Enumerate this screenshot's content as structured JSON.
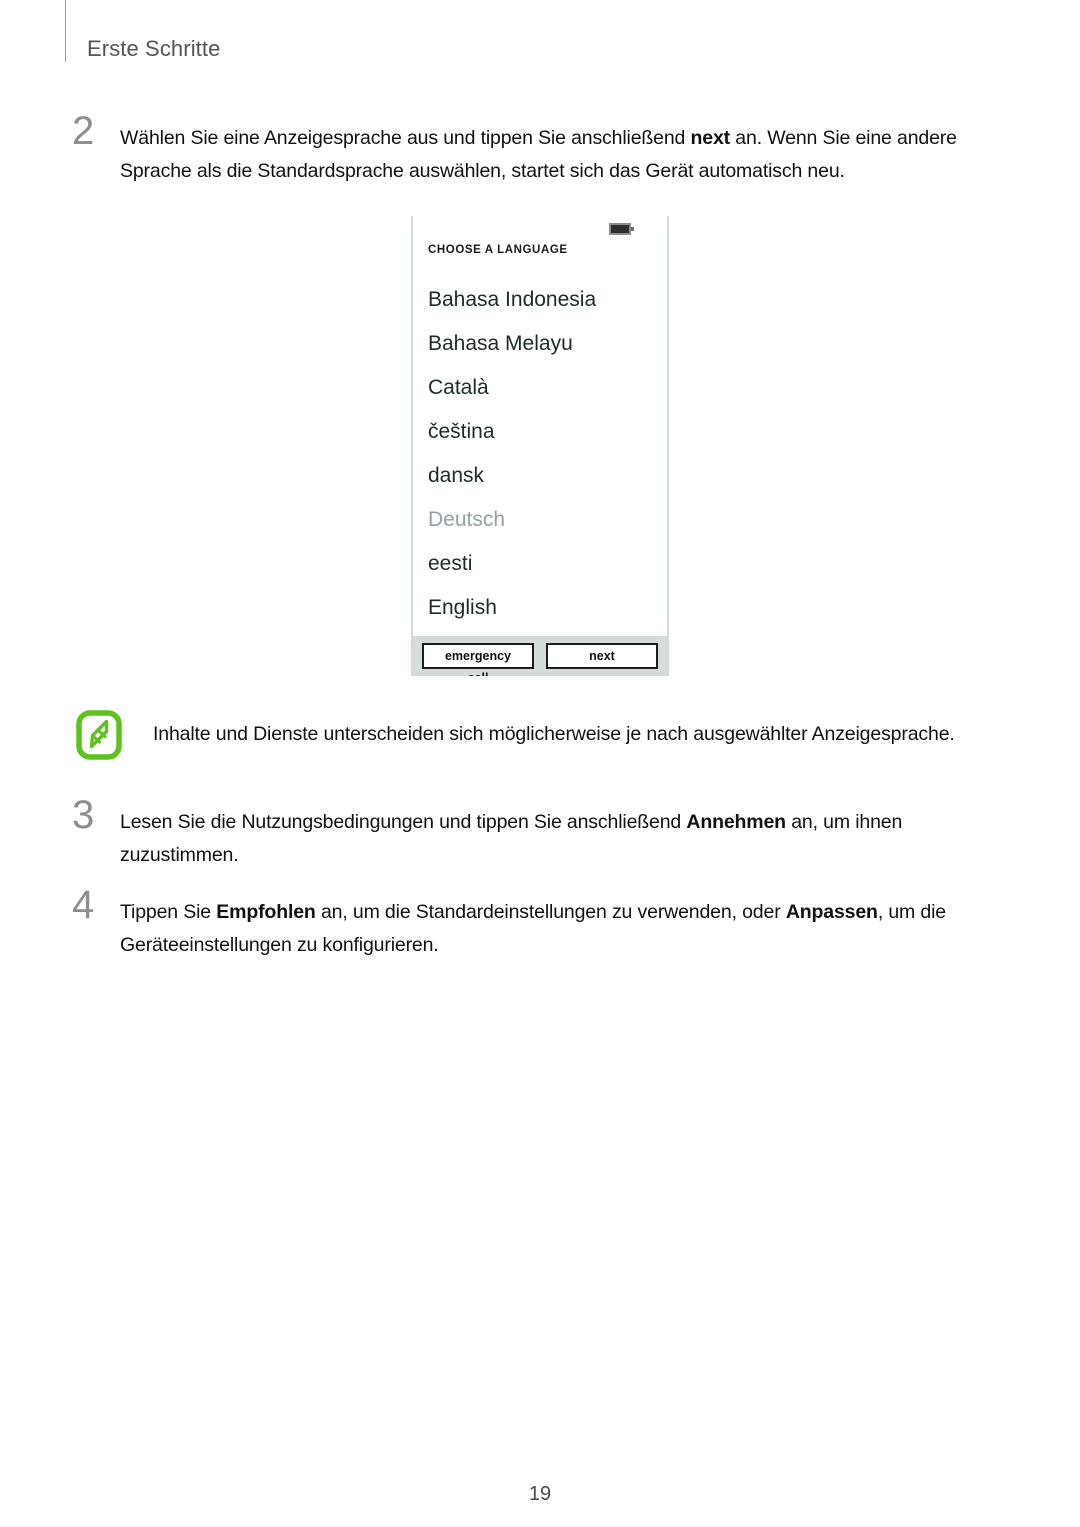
{
  "header": {
    "title": "Erste Schritte"
  },
  "steps": [
    {
      "number": "2",
      "parts": [
        {
          "text": "Wählen Sie eine Anzeigesprache aus und tippen Sie anschließend ",
          "bold": false
        },
        {
          "text": "next",
          "bold": true
        },
        {
          "text": " an. Wenn Sie eine andere Sprache als die Standardsprache auswählen, startet sich das Gerät automatisch neu.",
          "bold": false
        }
      ]
    },
    {
      "number": "3",
      "parts": [
        {
          "text": "Lesen Sie die Nutzungsbedingungen und tippen Sie anschließend ",
          "bold": false
        },
        {
          "text": "Annehmen",
          "bold": true
        },
        {
          "text": " an, um ihnen zuzustimmen.",
          "bold": false
        }
      ]
    },
    {
      "number": "4",
      "parts": [
        {
          "text": "Tippen Sie ",
          "bold": false
        },
        {
          "text": "Empfohlen",
          "bold": true
        },
        {
          "text": " an, um die Standardeinstellungen zu verwenden, oder ",
          "bold": false
        },
        {
          "text": "Anpassen",
          "bold": true
        },
        {
          "text": ", um die Geräteeinstellungen zu konfigurieren.",
          "bold": false
        }
      ]
    }
  ],
  "device_screenshot": {
    "status_bar": {
      "battery_icon": "battery-icon"
    },
    "title": "CHOOSE A LANGUAGE",
    "languages": [
      {
        "label": "Bahasa Indonesia",
        "selected": false
      },
      {
        "label": "Bahasa Melayu",
        "selected": false
      },
      {
        "label": "Català",
        "selected": false
      },
      {
        "label": "čeština",
        "selected": false
      },
      {
        "label": "dansk",
        "selected": false
      },
      {
        "label": "Deutsch",
        "selected": true
      },
      {
        "label": "eesti",
        "selected": false
      },
      {
        "label": "English",
        "selected": false
      }
    ],
    "buttons": {
      "emergency_call": "emergency call",
      "next": "next"
    }
  },
  "note": {
    "icon": "note-pen-icon",
    "icon_color": "#5dc21e",
    "text": "Inhalte und Dienste unterscheiden sich möglicherweise je nach ausgewählter Anzeigesprache."
  },
  "footer": {
    "page_number": "19"
  },
  "colors": {
    "header_text": "#555555",
    "body_text": "#111111",
    "step_number": "#8e8e8e",
    "device_border": "#cfdedd",
    "device_footer_bg": "#d6dcdc",
    "selected_language": "#8fa3a8",
    "note_green": "#5dc21e"
  }
}
